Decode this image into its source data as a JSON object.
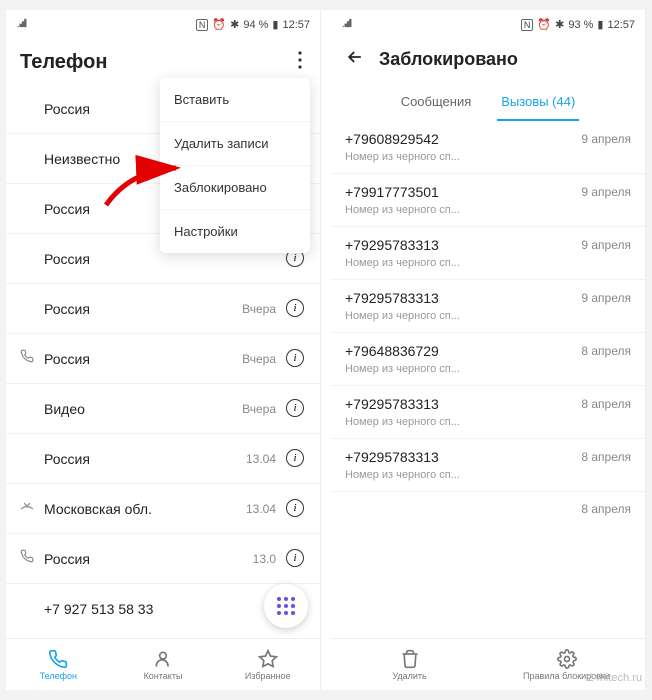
{
  "status": {
    "nfc": "N",
    "battery1": "94 %",
    "battery2": "93 %",
    "time": "12:57"
  },
  "left": {
    "title": "Телефон",
    "menu": {
      "paste": "Вставить",
      "delete": "Удалить записи",
      "blocked": "Заблокировано",
      "settings": "Настройки"
    },
    "rows": [
      {
        "name": "Россия",
        "time": "",
        "icon": ""
      },
      {
        "name": "Неизвестно",
        "time": "",
        "icon": ""
      },
      {
        "name": "Россия",
        "time": "",
        "icon": ""
      },
      {
        "name": "Россия",
        "time": "",
        "icon": ""
      },
      {
        "name": "Россия",
        "time": "Вчера",
        "icon": ""
      },
      {
        "name": "Россия",
        "time": "Вчера",
        "icon": "out"
      },
      {
        "name": "Видео",
        "time": "Вчера",
        "icon": ""
      },
      {
        "name": "Россия",
        "time": "13.04",
        "icon": ""
      },
      {
        "name": "Московская обл.",
        "time": "13.04",
        "icon": "missed"
      },
      {
        "name": "Россия",
        "time": "13.0",
        "icon": "out"
      },
      {
        "name": "+7 927 513 58 33",
        "time": "",
        "icon": ""
      }
    ],
    "nav": {
      "phone": "Телефон",
      "contacts": "Контакты",
      "favorites": "Избранное"
    }
  },
  "right": {
    "title": "Заблокировано",
    "tabs": {
      "messages": "Сообщения",
      "calls": "Вызовы (44)"
    },
    "subtext": "Номер из черного сп...",
    "rows": [
      {
        "num": "+79608929542",
        "date": "9 апреля"
      },
      {
        "num": "+79917773501",
        "date": "9 апреля"
      },
      {
        "num": "+79295783313",
        "date": "9 апреля"
      },
      {
        "num": "+79295783313",
        "date": "9 апреля"
      },
      {
        "num": "+79648836729",
        "date": "8 апреля"
      },
      {
        "num": "+79295783313",
        "date": "8 апреля"
      },
      {
        "num": "+79295783313",
        "date": "8 апреля"
      },
      {
        "num": "",
        "date": "8 апреля"
      }
    ],
    "nav": {
      "delete": "Удалить",
      "rules": "Правила блокировки"
    }
  },
  "watermark": "24hitech.ru"
}
